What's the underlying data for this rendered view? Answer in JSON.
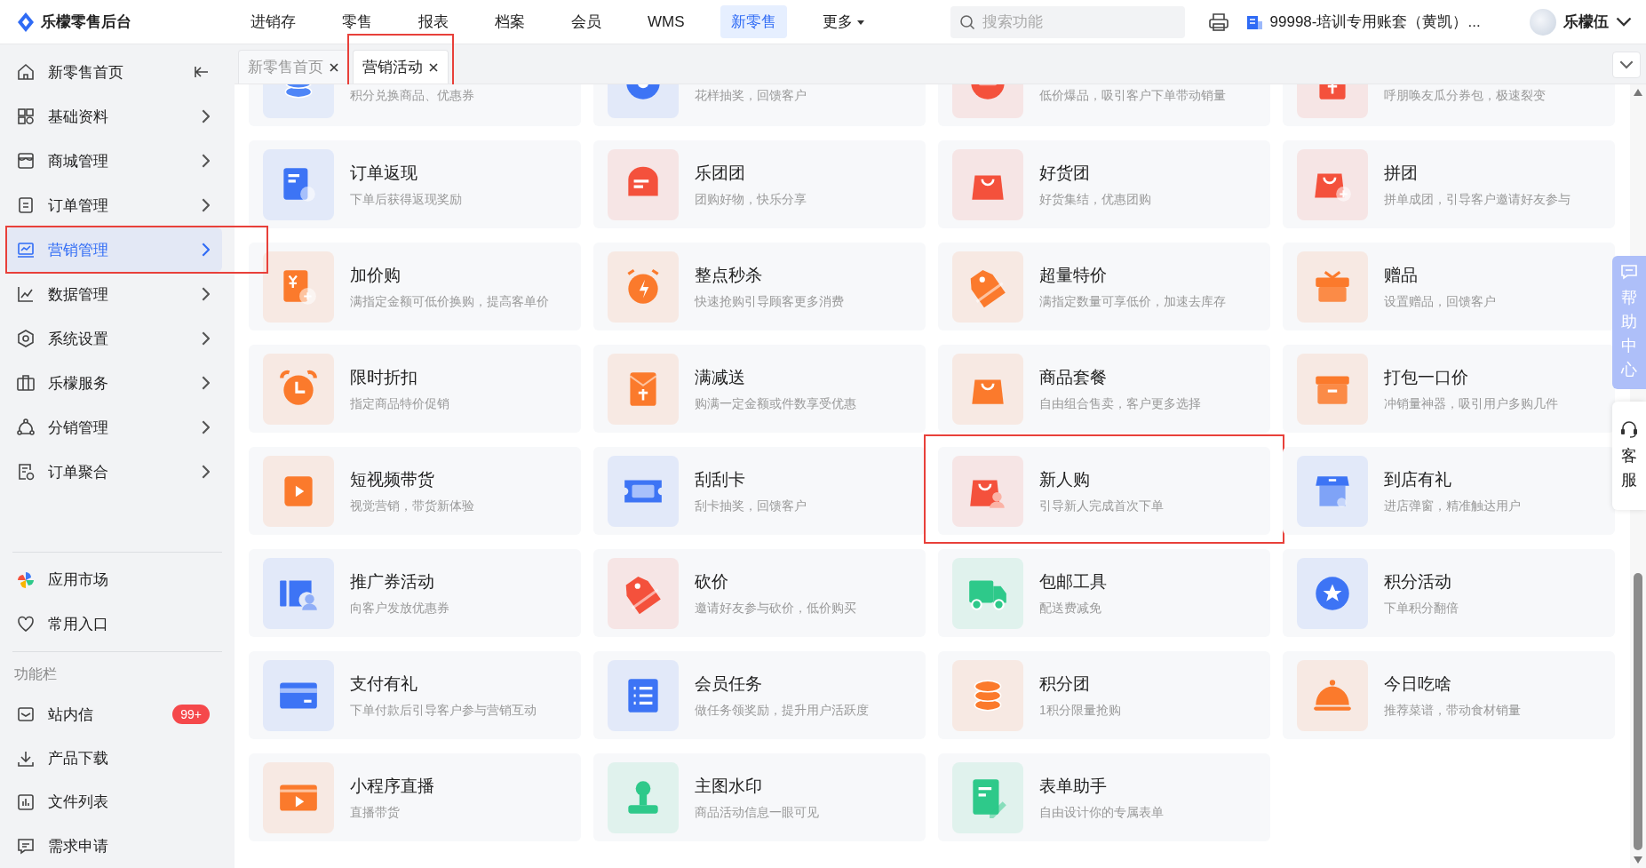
{
  "app": {
    "title": "乐檬零售后台"
  },
  "nav": [
    {
      "label": "进销存",
      "selected": false
    },
    {
      "label": "零售",
      "selected": false
    },
    {
      "label": "报表",
      "selected": false
    },
    {
      "label": "档案",
      "selected": false
    },
    {
      "label": "会员",
      "selected": false
    },
    {
      "label": "WMS",
      "selected": false
    },
    {
      "label": "新零售",
      "selected": true
    },
    {
      "label": "更多",
      "selected": false,
      "kind": "dropdown"
    }
  ],
  "search": {
    "placeholder": "搜索功能"
  },
  "account": {
    "label": "99998-培训专用账套（黄凯）..."
  },
  "user": {
    "name": "乐檬伍"
  },
  "tabs": [
    {
      "label": "新零售首页",
      "selected": false,
      "highlighted": false
    },
    {
      "label": "营销活动",
      "selected": true,
      "highlighted": true
    }
  ],
  "sidebar": {
    "items": [
      {
        "label": "新零售首页",
        "kind": "home",
        "selected": false,
        "highlighted": false
      },
      {
        "label": "基础资料",
        "kind": "menu",
        "selected": false,
        "highlighted": false
      },
      {
        "label": "商城管理",
        "kind": "menu",
        "selected": false,
        "highlighted": false
      },
      {
        "label": "订单管理",
        "kind": "menu",
        "selected": false,
        "highlighted": false
      },
      {
        "label": "营销管理",
        "kind": "menu",
        "selected": true,
        "highlighted": true
      },
      {
        "label": "数据管理",
        "kind": "menu",
        "selected": false,
        "highlighted": false
      },
      {
        "label": "系统设置",
        "kind": "menu",
        "selected": false,
        "highlighted": false
      },
      {
        "label": "乐檬服务",
        "kind": "menu",
        "selected": false,
        "highlighted": false
      },
      {
        "label": "分销管理",
        "kind": "menu",
        "selected": false,
        "highlighted": false
      },
      {
        "label": "订单聚合",
        "kind": "menu",
        "selected": false,
        "highlighted": false
      }
    ],
    "shortcuts": [
      {
        "label": "应用市场"
      },
      {
        "label": "常用入口"
      }
    ],
    "section_title": "功能栏",
    "tools": [
      {
        "label": "站内信",
        "badge": "99+"
      },
      {
        "label": "产品下载"
      },
      {
        "label": "文件列表"
      },
      {
        "label": "需求申请"
      }
    ]
  },
  "cards": [
    {
      "description": "积分兑换商品、优惠券",
      "color": "#4f86f7",
      "highlighted": false
    },
    {
      "description": "花样抽奖，回馈客户",
      "color": "#3d74f5",
      "highlighted": false
    },
    {
      "description": "低价爆品，吸引客户下单带动销量",
      "color": "#f4513c",
      "highlighted": false
    },
    {
      "description": "呼朋唤友瓜分券包，极速裂变",
      "color": "#f4513c",
      "highlighted": false
    },
    {
      "title": "订单返现",
      "description": "下单后获得返现奖励",
      "color": "#3d74f5",
      "highlighted": false
    },
    {
      "title": "乐团团",
      "description": "团购好物，快乐分享",
      "color": "#f4513c",
      "highlighted": false
    },
    {
      "title": "好货团",
      "description": "好货集结，优惠团购",
      "color": "#f4513c",
      "highlighted": false
    },
    {
      "title": "拼团",
      "description": "拼单成团，引导客户邀请好友参与",
      "color": "#f4513c",
      "highlighted": false
    },
    {
      "title": "加价购",
      "description": "满指定金额可低价换购，提高客单价",
      "color": "#fb7a2c",
      "highlighted": false
    },
    {
      "title": "整点秒杀",
      "description": "快速抢购引导顾客更多消费",
      "color": "#fb7a2c",
      "highlighted": false
    },
    {
      "title": "超量特价",
      "description": "满指定数量可享低价，加速去库存",
      "color": "#fb7a2c",
      "highlighted": false
    },
    {
      "title": "赠品",
      "description": "设置赠品，回馈客户",
      "color": "#fb7a2c",
      "highlighted": false
    },
    {
      "title": "限时折扣",
      "description": "指定商品特价促销",
      "color": "#fb7a2c",
      "highlighted": false
    },
    {
      "title": "满减送",
      "description": "购满一定金额或件数享受优惠",
      "color": "#fb7a2c",
      "highlighted": false
    },
    {
      "title": "商品套餐",
      "description": "自由组合售卖，客户更多选择",
      "color": "#fb7a2c",
      "highlighted": false
    },
    {
      "title": "打包一口价",
      "description": "冲销量神器，吸引用户多购几件",
      "color": "#fb7a2c",
      "highlighted": false
    },
    {
      "title": "短视频带货",
      "description": "视觉营销，带货新体验",
      "color": "#fb7a2c",
      "highlighted": false
    },
    {
      "title": "刮刮卡",
      "description": "刮卡抽奖，回馈客户",
      "color": "#3d74f5",
      "highlighted": false
    },
    {
      "title": "新人购",
      "description": "引导新人完成首次下单",
      "color": "#f4513c",
      "highlighted": true
    },
    {
      "title": "到店有礼",
      "description": "进店弹窗，精准触达用户",
      "color": "#3d74f5",
      "highlighted": false
    },
    {
      "title": "推广券活动",
      "description": "向客户发放优惠券",
      "color": "#3d74f5",
      "highlighted": false
    },
    {
      "title": "砍价",
      "description": "邀请好友参与砍价，低价购买",
      "color": "#f4513c",
      "highlighted": false
    },
    {
      "title": "包邮工具",
      "description": "配送费减免",
      "color": "#2ec98a",
      "highlighted": false
    },
    {
      "title": "积分活动",
      "description": "下单积分翻倍",
      "color": "#3d74f5",
      "highlighted": false
    },
    {
      "title": "支付有礼",
      "description": "下单付款后引导客户参与营销互动",
      "color": "#3d74f5",
      "highlighted": false
    },
    {
      "title": "会员任务",
      "description": "做任务领奖励，提升用户活跃度",
      "color": "#3d74f5",
      "highlighted": false
    },
    {
      "title": "积分团",
      "description": "1积分限量抢购",
      "color": "#fb7a2c",
      "highlighted": false
    },
    {
      "title": "今日吃啥",
      "description": "推荐菜谱，带动食材销量",
      "color": "#fb7a2c",
      "highlighted": false
    },
    {
      "title": "小程序直播",
      "description": "直播带货",
      "color": "#fb7a2c",
      "highlighted": false
    },
    {
      "title": "主图水印",
      "description": "商品活动信息一眼可见",
      "color": "#2ec98a",
      "highlighted": false
    },
    {
      "title": "表单助手",
      "description": "自由设计你的专属表单",
      "color": "#2ec98a",
      "highlighted": false
    }
  ],
  "help": {
    "label": "帮助中心"
  },
  "service": {
    "label": "客服"
  }
}
